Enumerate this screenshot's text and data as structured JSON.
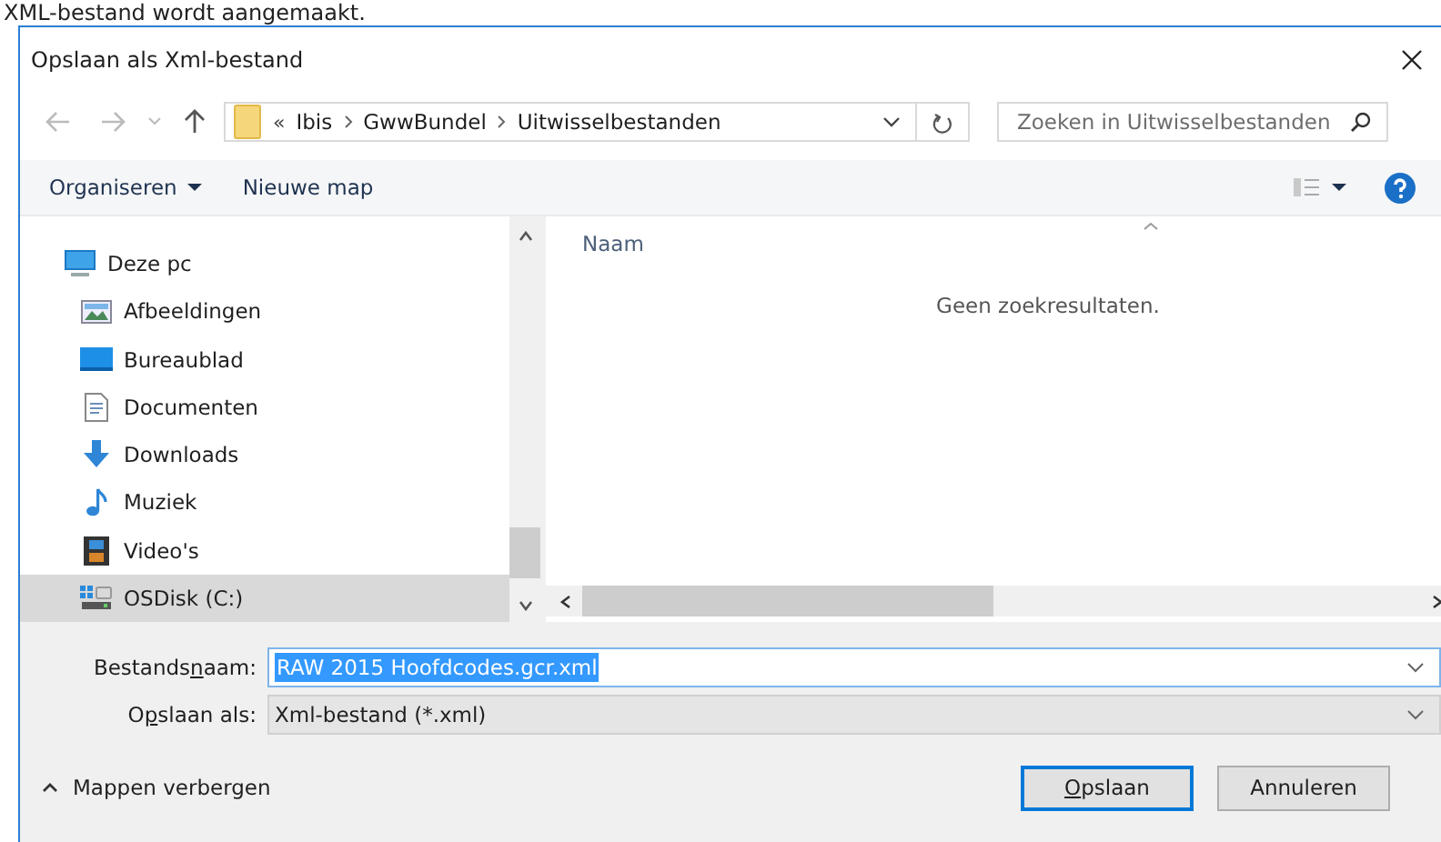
{
  "caption": "XML-bestand wordt aangemaakt.",
  "window": {
    "title": "Opslaan als Xml-bestand"
  },
  "address": {
    "overflow": "«",
    "crumbs": [
      "Ibis",
      "GwwBundel",
      "Uitwisselbestanden"
    ]
  },
  "search": {
    "placeholder": "Zoeken in Uitwisselbestanden"
  },
  "toolbar": {
    "organize": "Organiseren",
    "new_folder": "Nieuwe map"
  },
  "sidebar": {
    "items": [
      {
        "label": "Deze pc",
        "kind": "pc",
        "selected": false
      },
      {
        "label": "Afbeeldingen",
        "kind": "pictures",
        "selected": false
      },
      {
        "label": "Bureaublad",
        "kind": "desktop",
        "selected": false
      },
      {
        "label": "Documenten",
        "kind": "documents",
        "selected": false
      },
      {
        "label": "Downloads",
        "kind": "downloads",
        "selected": false
      },
      {
        "label": "Muziek",
        "kind": "music",
        "selected": false
      },
      {
        "label": "Video's",
        "kind": "videos",
        "selected": false
      },
      {
        "label": "OSDisk (C:)",
        "kind": "disk",
        "selected": true
      }
    ]
  },
  "file_list": {
    "column": "Naam",
    "empty_text": "Geen zoekresultaten."
  },
  "filename": {
    "label": "Bestands**n**aam:",
    "value": "RAW 2015 Hoofdcodes.gcr.xml"
  },
  "filetype": {
    "label": "O**p**slaan als:",
    "value": "Xml-bestand (*.xml)"
  },
  "hide_folders": "Mappen verbergen",
  "buttons": [
    {
      "label": "**O**pslaan",
      "kind": "primary"
    },
    {
      "label": "Annuleren",
      "kind": "secondary"
    }
  ]
}
